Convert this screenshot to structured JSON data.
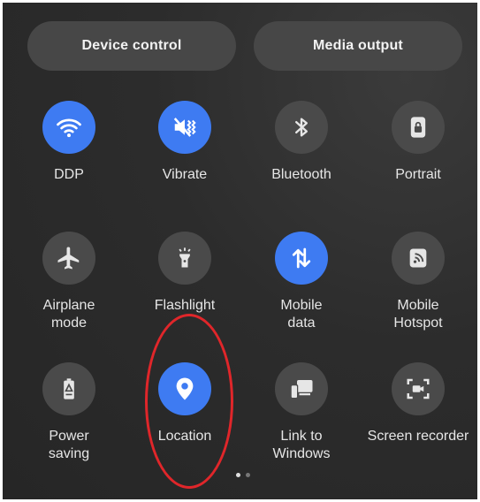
{
  "header": {
    "device_control_label": "Device control",
    "media_output_label": "Media output"
  },
  "tiles": [
    {
      "label": "DDP",
      "icon": "wifi-icon",
      "active": true
    },
    {
      "label": "Vibrate",
      "icon": "vibrate-icon",
      "active": true
    },
    {
      "label": "Bluetooth",
      "icon": "bluetooth-icon",
      "active": false
    },
    {
      "label": "Portrait",
      "icon": "portrait-lock-icon",
      "active": false
    },
    {
      "label": "Airplane\nmode",
      "icon": "airplane-icon",
      "active": false
    },
    {
      "label": "Flashlight",
      "icon": "flashlight-icon",
      "active": false
    },
    {
      "label": "Mobile\ndata",
      "icon": "mobile-data-icon",
      "active": true
    },
    {
      "label": "Mobile\nHotspot",
      "icon": "hotspot-icon",
      "active": false
    },
    {
      "label": "Power\nsaving",
      "icon": "battery-icon",
      "active": false
    },
    {
      "label": "Location",
      "icon": "location-pin-icon",
      "active": true
    },
    {
      "label": "Link to\nWindows",
      "icon": "link-to-windows-icon",
      "active": false
    },
    {
      "label": "Screen recorder",
      "icon": "screen-recorder-icon",
      "active": false
    }
  ],
  "pager": {
    "pages": 2,
    "current": 1
  },
  "colors": {
    "active": "#3e7bf2",
    "inactive": "#4a4a4a",
    "annotation": "#e0262a"
  }
}
